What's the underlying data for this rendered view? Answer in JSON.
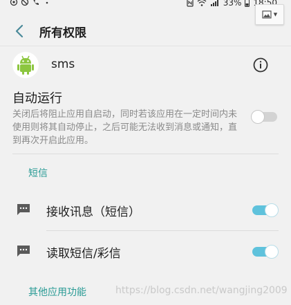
{
  "status_bar": {
    "battery": "33%",
    "time": "18:50"
  },
  "header": {
    "title": "所有权限"
  },
  "app": {
    "name": "sms",
    "icon": "android-robot-icon"
  },
  "autorun": {
    "title": "自动运行",
    "description": "关闭后将阻止应用自启动，同时若该应用在一定时间内未使用则将其自动停止，之后可能无法收到消息或通知，直到再次开启此应用。",
    "enabled": false
  },
  "sections": [
    {
      "label": "短信",
      "items": [
        {
          "label": "接收讯息（短信）",
          "icon": "message-icon",
          "enabled": true
        },
        {
          "label": "读取短信/彩信",
          "icon": "message-icon",
          "enabled": true
        }
      ]
    },
    {
      "label": "其他应用功能",
      "items": []
    }
  ],
  "watermark": "https://blog.csdn.net/wangjing2009",
  "colors": {
    "accent": "#2a9b95",
    "toggle_on": "#5fc2dc",
    "background": "#f1f1f1"
  }
}
